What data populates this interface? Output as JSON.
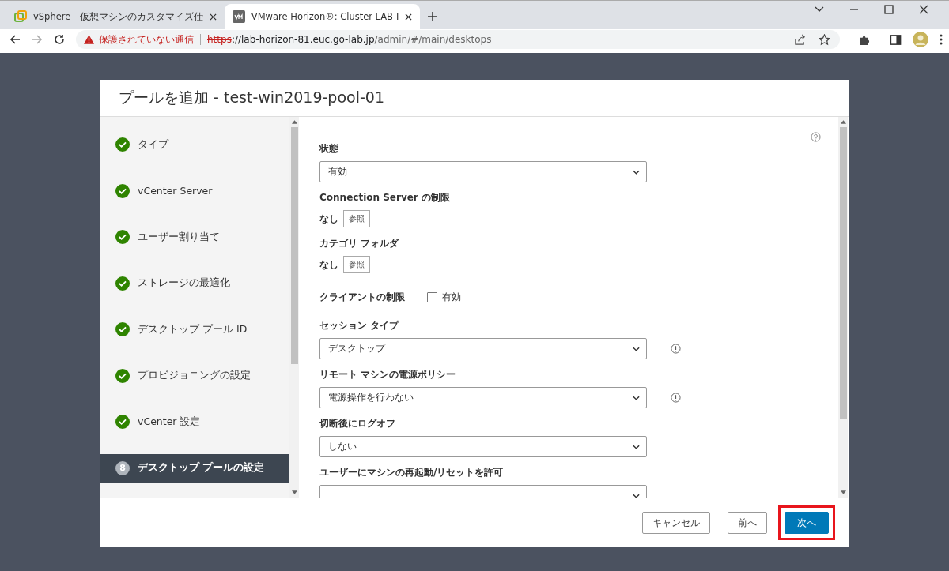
{
  "browser": {
    "tabs": [
      {
        "title": "vSphere - 仮想マシンのカスタマイズ仕",
        "selected": false
      },
      {
        "title": "VMware Horizon®: Cluster-LAB-I",
        "selected": true
      }
    ],
    "address": {
      "warning": "保護されていない通信",
      "scheme": "https",
      "host": "://lab-horizon-81.euc.go-lab.jp",
      "path": "/admin/#/main/desktops"
    }
  },
  "dialog": {
    "title": "プールを追加 - test-win2019-pool-01",
    "steps": [
      {
        "label": "タイプ",
        "completed": true,
        "selected": false
      },
      {
        "label": "vCenter Server",
        "completed": true,
        "selected": false
      },
      {
        "label": "ユーザー割り当て",
        "completed": true,
        "selected": false
      },
      {
        "label": "ストレージの最適化",
        "completed": true,
        "selected": false
      },
      {
        "label": "デスクトップ プール ID",
        "completed": true,
        "selected": false
      },
      {
        "label": "プロビジョニングの設定",
        "completed": true,
        "selected": false
      },
      {
        "label": "vCenter 設定",
        "completed": true,
        "selected": false
      },
      {
        "label": "デスクトップ プールの設定",
        "completed": false,
        "selected": true,
        "number": "8"
      }
    ],
    "fields": [
      {
        "kind": "select",
        "label": "状態",
        "value": "有効",
        "info": false
      },
      {
        "kind": "browse",
        "label": "Connection Server の制限",
        "value": "なし",
        "button": "参照"
      },
      {
        "kind": "browse",
        "label": "カテゴリ フォルダ",
        "value": "なし",
        "button": "参照"
      },
      {
        "kind": "checkbox",
        "label": "クライアントの制限",
        "option": "有効",
        "checked": false
      },
      {
        "kind": "select",
        "label": "セッション タイプ",
        "value": "デスクトップ",
        "info": true
      },
      {
        "kind": "select",
        "label": "リモート マシンの電源ポリシー",
        "value": "電源操作を行わない",
        "info": true
      },
      {
        "kind": "select",
        "label": "切断後にログオフ",
        "value": "しない",
        "info": false
      },
      {
        "kind": "select",
        "label": "ユーザーにマシンの再起動/リセットを許可"
      }
    ],
    "buttons": [
      {
        "label": "キャンセル",
        "primary": false,
        "highlighted": false
      },
      {
        "label": "前へ",
        "primary": false,
        "highlighted": false
      },
      {
        "label": "次へ",
        "primary": true,
        "highlighted": true
      }
    ]
  }
}
